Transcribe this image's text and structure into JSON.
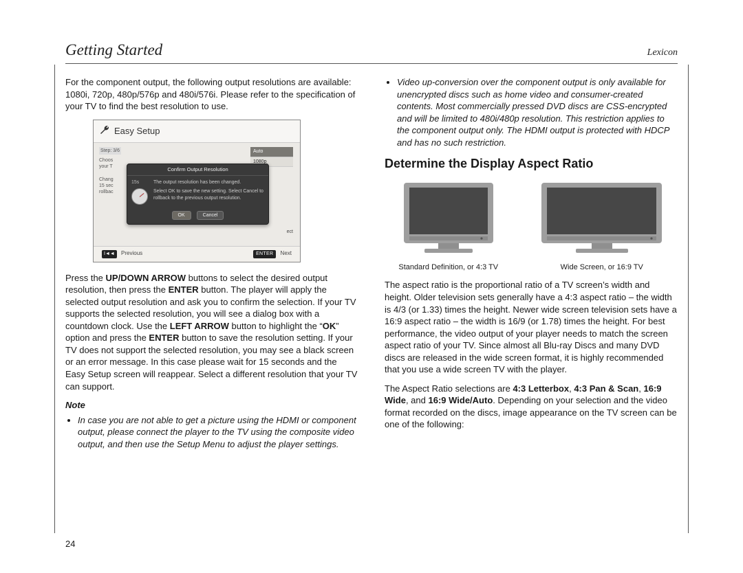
{
  "header": {
    "title": "Getting Started",
    "brand": "Lexicon"
  },
  "page_number": "24",
  "left": {
    "intro": "For the component output, the following output resolutions are available: 1080i, 720p, 480p/576p and 480i/576i. Please refer to the specification of your TV to find the best resolution to use.",
    "shot": {
      "title": "Easy Setup",
      "step": "Step: 3/6",
      "choose1": "Choos",
      "choose2": "your T",
      "change1": "Chang",
      "change2": "15 sec",
      "change3": "rollbac",
      "res_auto": "Auto",
      "res_1080p": "1080p",
      "modal_title": "Confirm Output Resolution",
      "modal_timer": "15s",
      "modal_line1": "The output resolution has been changed.",
      "modal_line2": "Select OK to save the new setting. Select Cancel to rollback to the previous output resolution.",
      "btn_ok": "OK",
      "btn_cancel": "Cancel",
      "select_hint": "ect",
      "prev_label": "Previous",
      "enter_key": "ENTER",
      "next_label": "Next",
      "skip_icon": "I◄◄"
    },
    "body_html": "Press the <b>UP/DOWN ARROW</b> buttons to select the desired output resolution, then press the <b>ENTER</b> button. The player will apply the selected output resolution and ask you to confirm the selection. If your TV supports the selected resolution, you will see a dialog box with a countdown clock. Use the <b>LEFT ARROW</b> button to highlight the “<b>OK</b>” option and press the <b>ENTER</b> button to save the resolution setting. If your TV does not support the selected resolution, you may see a black screen or an error message. In this case please wait for 15 seconds and the Easy Setup screen will reappear. Select a different resolution that your TV can support.",
    "note_label": "Note",
    "note_bullet": "In case you are not able to get a picture using the HDMI or component output, please connect the player to the TV using the composite video output, and then use the Setup Menu to adjust the player settings."
  },
  "right": {
    "top_bullet": "Video up-conversion over the component output is only available for unencrypted discs such as home video and consumer-created contents. Most commercially pressed DVD discs are CSS-encrypted and will be limited to 480i/480p resolution. This restriction applies to the component output only. The HDMI output is protected with HDCP and has no such restriction.",
    "section_title": "Determine the Display Aspect Ratio",
    "tv43_caption": "Standard Definition, or 4:3 TV",
    "tv169_caption": "Wide Screen, or 16:9 TV",
    "para1": "The aspect ratio is the proportional ratio of a TV screen’s width and height. Older television sets generally have a 4:3 aspect ratio – the width is 4/3 (or 1.33) times the height. Newer wide screen television sets have a 16:9 aspect ratio – the width is 16/9 (or 1.78) times the height. For best performance, the video output of your player needs to match the screen aspect ratio of your TV. Since almost all Blu-ray Discs and many DVD discs are released in the wide screen format, it is highly recommended that you use a wide screen TV with the player.",
    "para2_html": "The Aspect Ratio selections are <b>4:3 Letterbox</b>, <b>4:3 Pan &amp; Scan</b>, <b>16:9 Wide</b>, and <b>16:9 Wide/Auto</b>. Depending on your selection and the video format recorded on the discs, image appearance on the TV screen can be one of the following:"
  }
}
